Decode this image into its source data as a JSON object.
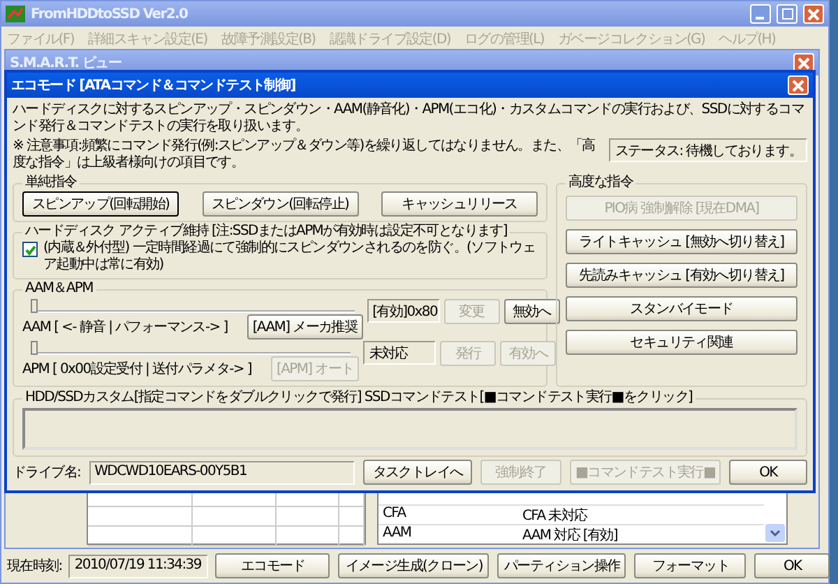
{
  "main_window": {
    "title": "FromHDDtoSSD Ver2.0",
    "menu": [
      "ファイル(F)",
      "詳細スキャン設定(E)",
      "故障予測設定(B)",
      "認識ドライブ設定(D)",
      "ログの管理(L)",
      "ガベージコレクション(G)",
      "ヘルプ(H)"
    ],
    "clock_label": "現在時刻:",
    "clock_value": "2010/07/19 11:34:39",
    "buttons": [
      {
        "label": "エコモード",
        "disabled": false
      },
      {
        "label": "イメージ生成(クローン)",
        "disabled": false
      },
      {
        "label": "パーティション操作",
        "disabled": false
      },
      {
        "label": "フォーマット",
        "disabled": false
      },
      {
        "label": "OK",
        "disabled": false
      }
    ]
  },
  "smart_window": {
    "title": "S.M.A.R.T. ビュー",
    "attributes": [
      {
        "name": "CFA",
        "value": "CFA 未対応"
      },
      {
        "name": "AAM",
        "value": "AAM 対応 [有効]"
      }
    ]
  },
  "dialog": {
    "title": "エコモード [ATAコマンド＆コマンドテスト制御]",
    "description": "ハードディスクに対するスピンアップ・スピンダウン・AAM(静音化)・APM(エコ化)・カスタムコマンドの実行および、SSDに対するコマンド発行＆コマンドテストの実行を取り扱います。",
    "notice": "※ 注意事項:頻繁にコマンド発行(例:スピンアップ＆ダウン等)を繰り返してはなりません。また、「高度な指令」は上級者様向けの項目です。",
    "status": "ステータス: 待機しております。",
    "simple_group": {
      "title": "単純指令",
      "buttons": [
        {
          "label": "スピンアップ(回転開始)",
          "disabled": false,
          "focused": true
        },
        {
          "label": "スピンダウン(回転停止)",
          "disabled": false,
          "focused": false
        },
        {
          "label": "キャッシュリリース",
          "disabled": false,
          "focused": false
        }
      ]
    },
    "active_group": {
      "title": "ハードディスク アクティブ維持 [注:SSDまたはAPMが有効時は設定不可となります]",
      "checkbox": {
        "label": "(内蔵＆外付型) 一定時間経過にて強制的にスピンダウンされるのを防ぐ。(ソフトウェア起動中は常に有効)",
        "checked": true
      }
    },
    "aam_group": {
      "title": "AAM＆APM",
      "rows": [
        {
          "label": "AAM [ <- 静音 | パフォーマンス-> ]",
          "level": 0,
          "preset": {
            "label": "[AAM] メーカ推奨",
            "disabled": false
          },
          "reading": "[有効]0x80",
          "buttons": [
            {
              "label": "変更",
              "disabled": true
            },
            {
              "label": "無効へ",
              "disabled": false
            }
          ]
        },
        {
          "label": "APM [ 0x00設定受付 | 送付パラメタ-> ]",
          "level": 0,
          "preset": {
            "label": "[APM] オート",
            "disabled": true
          },
          "reading": "未対応",
          "buttons": [
            {
              "label": "発行",
              "disabled": true
            },
            {
              "label": "有効へ",
              "disabled": true
            }
          ]
        }
      ]
    },
    "advanced_group": {
      "title": "高度な指令",
      "buttons": [
        {
          "label": "PIO病 強制解除 [現在DMA]",
          "disabled": true
        },
        {
          "label": "ライトキャッシュ [無効へ切り替え]",
          "disabled": false
        },
        {
          "label": "先読みキャッシュ [有効へ切り替え]",
          "disabled": false
        },
        {
          "label": "スタンバイモード",
          "disabled": false
        },
        {
          "label": "セキュリティ関連",
          "disabled": false
        }
      ]
    },
    "custom_group": {
      "title": "HDD/SSDカスタム[指定コマンドをダブルクリックで発行] SSDコマンドテスト[■コマンドテスト実行■をクリック]"
    },
    "drive_label": "ドライブ名:",
    "drive_value": "WDCWD10EARS-00Y5B1",
    "buttons": [
      {
        "label": "タスクトレイへ",
        "disabled": false
      },
      {
        "label": "強制終了",
        "disabled": true
      },
      {
        "label": "■コマンドテスト実行■",
        "disabled": true
      },
      {
        "label": "OK",
        "disabled": false
      }
    ]
  }
}
